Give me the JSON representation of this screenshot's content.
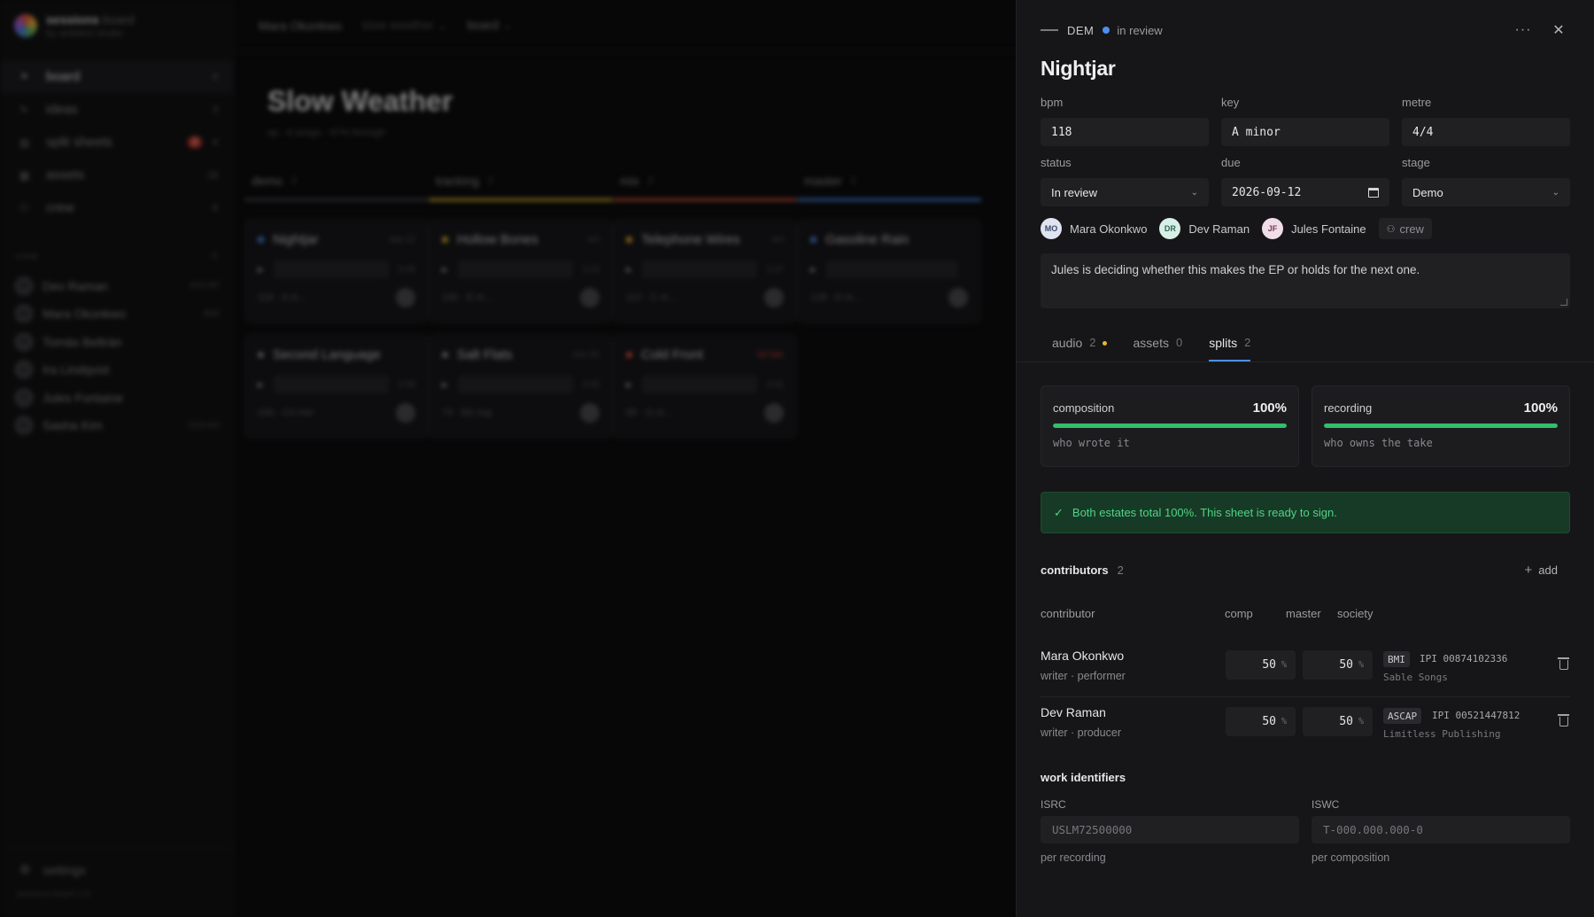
{
  "app": {
    "brand": "sessions",
    "brand_suffix": "board",
    "brand_sub": "by ambient studio",
    "nav": [
      {
        "icon": "flag-icon",
        "glyph": "⚑",
        "label": "board",
        "count": "6",
        "active": true
      },
      {
        "icon": "pencil-icon",
        "glyph": "✎",
        "label": "ideas",
        "count": "3",
        "active": false
      },
      {
        "icon": "document-icon",
        "glyph": "▤",
        "label": "split sheets",
        "badge": "2",
        "count": "4",
        "active": false
      },
      {
        "icon": "folder-icon",
        "glyph": "▦",
        "label": "assets",
        "count": "18",
        "active": false
      },
      {
        "icon": "people-icon",
        "glyph": "⚇",
        "label": "crew",
        "count": "6",
        "active": false
      }
    ],
    "crew_heading": "crew",
    "crew_count": "6",
    "crew": [
      {
        "initials": "DR",
        "name": "Dev Raman",
        "society": "ASCAP"
      },
      {
        "initials": "MO",
        "name": "Mara Okonkwo",
        "society": "BMI"
      },
      {
        "initials": "TB",
        "name": "Tomás Beltrán",
        "society": ""
      },
      {
        "initials": "IL",
        "name": "Ira Lindqvist",
        "society": ""
      },
      {
        "initials": "JF",
        "name": "Jules Fontaine",
        "society": ""
      },
      {
        "initials": "SK",
        "name": "Sasha Kim",
        "society": "SOCAN"
      }
    ],
    "settings": "settings",
    "version": "sessions board 1.0"
  },
  "topbar": {
    "artist": "Mara Okonkwo",
    "project": "slow weather",
    "view": "board"
  },
  "board": {
    "title": "Slow Weather",
    "meta": "ep · 6 songs · 67% through",
    "columns": [
      {
        "name": "demo",
        "count": "2",
        "color": "#4a4a4e",
        "cards": [
          {
            "title": "Nightjar",
            "dot": "#4e8ef0",
            "due": "sep 12",
            "late": false,
            "len": "3:48",
            "meta": "118 · A m…"
          },
          {
            "title": "Second Language",
            "dot": "#8a8a8e",
            "due": "",
            "late": false,
            "len": "2:59",
            "meta": "100 · C# min"
          }
        ]
      },
      {
        "name": "tracking",
        "count": "2",
        "color": "#e7b733",
        "cards": [
          {
            "title": "Hollow Bones",
            "dot": "#e7b733",
            "due": "oct",
            "late": false,
            "len": "3:15",
            "meta": "140 · E m…"
          },
          {
            "title": "Salt Flats",
            "dot": "#8a8a8e",
            "due": "nov 02",
            "late": false,
            "len": "4:20",
            "meta": "74 · Eb maj"
          }
        ]
      },
      {
        "name": "mix",
        "count": "2",
        "color": "#e0553c",
        "cards": [
          {
            "title": "Telephone Wires",
            "dot": "#e7b733",
            "due": "oct",
            "late": false,
            "len": "3:37",
            "meta": "112 · C m…"
          },
          {
            "title": "Cold Front",
            "dot": "#e0553c",
            "due": "3d late",
            "late": true,
            "len": "4:31",
            "meta": "85 · G m…"
          }
        ]
      },
      {
        "name": "master",
        "count": "1",
        "color": "#4e8ef0",
        "cards": [
          {
            "title": "Gasoline Rain",
            "dot": "#4e8ef0",
            "due": "",
            "late": false,
            "len": "",
            "meta": "128 · D m…"
          }
        ]
      }
    ]
  },
  "drawer": {
    "code": "DEM",
    "status": "in review",
    "title": "Nightjar",
    "fields": {
      "bpm_label": "bpm",
      "bpm": "118",
      "key_label": "key",
      "key": "A minor",
      "metre_label": "metre",
      "metre": "4/4",
      "status_label": "status",
      "status": "In review",
      "due_label": "due",
      "due": "2026-09-12",
      "stage_label": "stage",
      "stage": "Demo"
    },
    "people": [
      {
        "initials": "MO",
        "name": "Mara Okonkwo",
        "bg": "#dfe4f0",
        "fg": "#3b4a6b"
      },
      {
        "initials": "DR",
        "name": "Dev Raman",
        "bg": "#d7efe6",
        "fg": "#2f6a55"
      },
      {
        "initials": "JF",
        "name": "Jules Fontaine",
        "bg": "#efdde8",
        "fg": "#7a3a5c"
      }
    ],
    "crew_button": "crew",
    "notes": "Jules is deciding whether this makes the EP or holds for the next one.",
    "tabs": [
      {
        "label": "audio",
        "count": "2",
        "dot": true,
        "active": false
      },
      {
        "label": "assets",
        "count": "0",
        "dot": false,
        "active": false
      },
      {
        "label": "splits",
        "count": "2",
        "dot": false,
        "active": true
      }
    ],
    "estates": [
      {
        "name": "composition",
        "pct_label": "100%",
        "pct": 100,
        "sub": "who wrote it"
      },
      {
        "name": "recording",
        "pct_label": "100%",
        "pct": 100,
        "sub": "who owns the take"
      }
    ],
    "ok_message": "Both estates total 100%. This sheet is ready to sign.",
    "contributors_title": "contributors",
    "contributors_count": "2",
    "add_label": "add",
    "table_headers": {
      "contributor": "contributor",
      "comp": "comp",
      "master": "master",
      "society": "society"
    },
    "contributors": [
      {
        "name": "Mara Okonkwo",
        "role": "writer · performer",
        "comp": "50",
        "master": "50",
        "society": "BMI",
        "ipi": "IPI 00874102336",
        "publisher": "Sable Songs"
      },
      {
        "name": "Dev Raman",
        "role": "writer · producer",
        "comp": "50",
        "master": "50",
        "society": "ASCAP",
        "ipi": "IPI 00521447812",
        "publisher": "Limitless Publishing"
      }
    ],
    "pct_unit": "%",
    "work_identifiers_title": "work identifiers",
    "isrc_label": "ISRC",
    "isrc_placeholder": "USLM72500000",
    "isrc_hint": "per recording",
    "iswc_label": "ISWC",
    "iswc_placeholder": "T-000.000.000-0",
    "iswc_hint": "per composition"
  }
}
